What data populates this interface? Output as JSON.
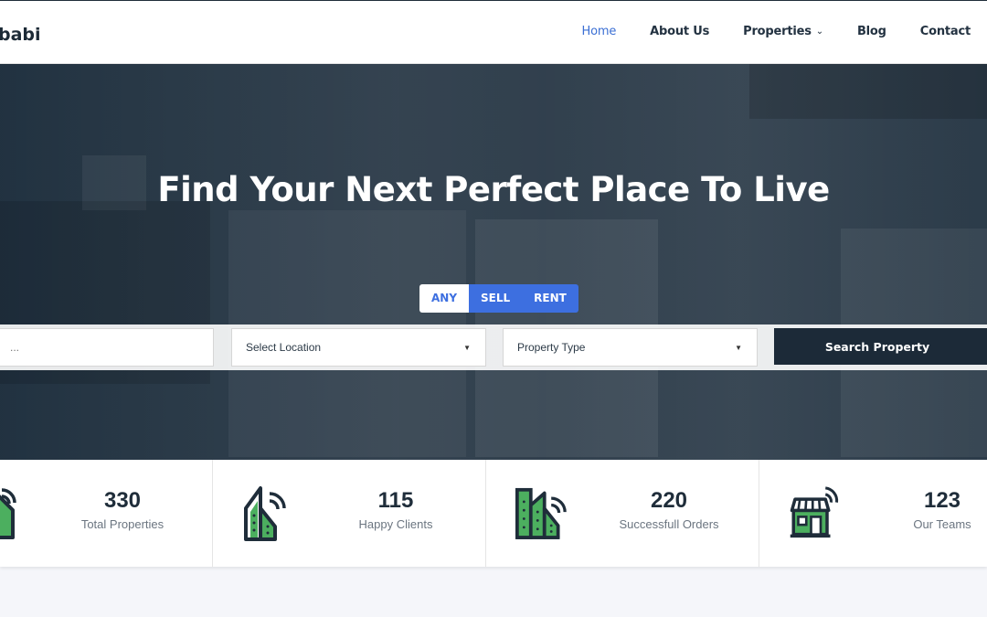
{
  "brand": {
    "logo_text": "babi"
  },
  "nav": {
    "items": [
      {
        "label": "Home",
        "active": true
      },
      {
        "label": "About Us"
      },
      {
        "label": "Properties",
        "has_dropdown": true,
        "icon": "chevron-down-icon"
      },
      {
        "label": "Blog"
      },
      {
        "label": "Contact"
      }
    ]
  },
  "hero": {
    "title": "Find Your Next Perfect Place To Live",
    "tabs": [
      {
        "label": "ANY",
        "active": true
      },
      {
        "label": "SELL"
      },
      {
        "label": "RENT"
      }
    ],
    "search": {
      "keyword_placeholder": "...",
      "location_select": "Select Location",
      "type_select": "Property Type",
      "button_label": "Search Property"
    }
  },
  "stats": [
    {
      "value": "330",
      "label": "Total Properties",
      "icon": "house-wifi-icon"
    },
    {
      "value": "115",
      "label": "Happy Clients",
      "icon": "building-wifi-icon"
    },
    {
      "value": "220",
      "label": "Successfull Orders",
      "icon": "buildings-wifi-icon"
    },
    {
      "value": "123",
      "label": "Our Teams",
      "icon": "store-wifi-icon"
    }
  ],
  "colors": {
    "accent": "#3d6fe0",
    "dark": "#1c2a38",
    "icon_green": "#4caf5f"
  }
}
